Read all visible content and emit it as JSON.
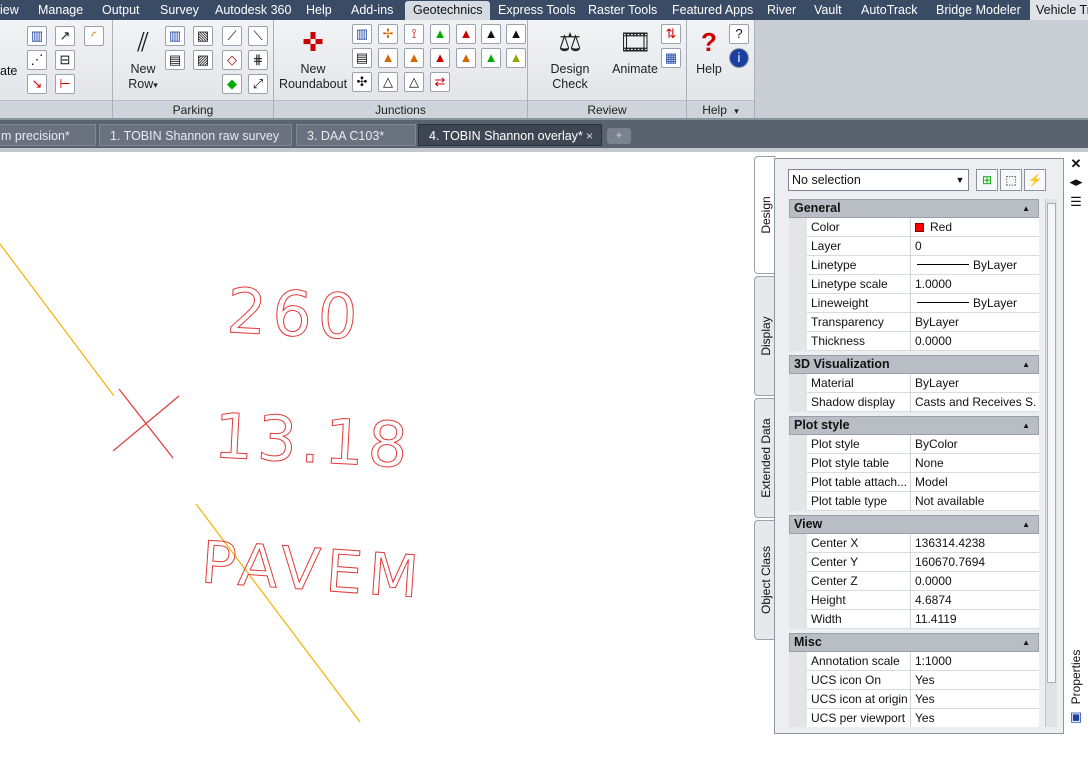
{
  "menu": {
    "tabs": [
      "iew",
      "Manage",
      "Output",
      "Survey",
      "Autodesk 360",
      "Help",
      "Add-ins",
      "Geotechnics",
      "Express Tools",
      "Raster Tools",
      "Featured Apps",
      "River",
      "Vault",
      "AutoTrack",
      "Bridge Modeler",
      "Vehicle Tr"
    ],
    "active": "Geotechnics"
  },
  "ribbon": {
    "partial_label": "ate",
    "new_row": {
      "line1": "New",
      "line2": "Row",
      "arrow": "▾"
    },
    "new_roundabout": {
      "line1": "New",
      "line2": "Roundabout"
    },
    "design_check": "Design Check",
    "animate": "Animate",
    "help": "Help",
    "panels": {
      "parking": "Parking",
      "junctions": "Junctions",
      "review": "Review",
      "help": "Help"
    },
    "help_arrow": "▾"
  },
  "doc_tabs": {
    "tab1": "m precision*",
    "tab2": "1. TOBIN Shannon raw survey",
    "tab3": "3. DAA C103*",
    "tab4": "4. TOBIN Shannon overlay*",
    "close_glyph": "×",
    "new_glyph": "+"
  },
  "drawing": {
    "text_260": "260",
    "text_elev": "13.18",
    "text_pavem": "PAVEM"
  },
  "properties": {
    "title": "Properties",
    "selection": "No selection",
    "side_tabs": [
      "Design",
      "Display",
      "Extended Data",
      "Object Class"
    ],
    "sections": {
      "general": {
        "title": "General",
        "rows": [
          {
            "k": "Color",
            "v": "Red"
          },
          {
            "k": "Layer",
            "v": "0"
          },
          {
            "k": "Linetype",
            "v": "ByLayer"
          },
          {
            "k": "Linetype scale",
            "v": "1.0000"
          },
          {
            "k": "Lineweight",
            "v": "ByLayer"
          },
          {
            "k": "Transparency",
            "v": "ByLayer"
          },
          {
            "k": "Thickness",
            "v": "0.0000"
          }
        ]
      },
      "viz": {
        "title": "3D Visualization",
        "rows": [
          {
            "k": "Material",
            "v": "ByLayer"
          },
          {
            "k": "Shadow display",
            "v": "Casts and Receives S..."
          }
        ]
      },
      "plot": {
        "title": "Plot style",
        "rows": [
          {
            "k": "Plot style",
            "v": "ByColor"
          },
          {
            "k": "Plot style table",
            "v": "None"
          },
          {
            "k": "Plot table attach...",
            "v": "Model"
          },
          {
            "k": "Plot table type",
            "v": "Not available"
          }
        ]
      },
      "view": {
        "title": "View",
        "rows": [
          {
            "k": "Center X",
            "v": "136314.4238"
          },
          {
            "k": "Center Y",
            "v": "160670.7694"
          },
          {
            "k": "Center Z",
            "v": "0.0000"
          },
          {
            "k": "Height",
            "v": "4.6874"
          },
          {
            "k": "Width",
            "v": "11.4119"
          }
        ]
      },
      "misc": {
        "title": "Misc",
        "rows": [
          {
            "k": "Annotation scale",
            "v": "1:1000"
          },
          {
            "k": "UCS icon On",
            "v": "Yes"
          },
          {
            "k": "UCS icon at origin",
            "v": "Yes"
          },
          {
            "k": "UCS per viewport",
            "v": "Yes"
          }
        ]
      }
    }
  },
  "colors": {
    "menu_bg": "#3a4b66",
    "drawing_text": "#e03a3a",
    "drawing_line": "#f0b400"
  }
}
